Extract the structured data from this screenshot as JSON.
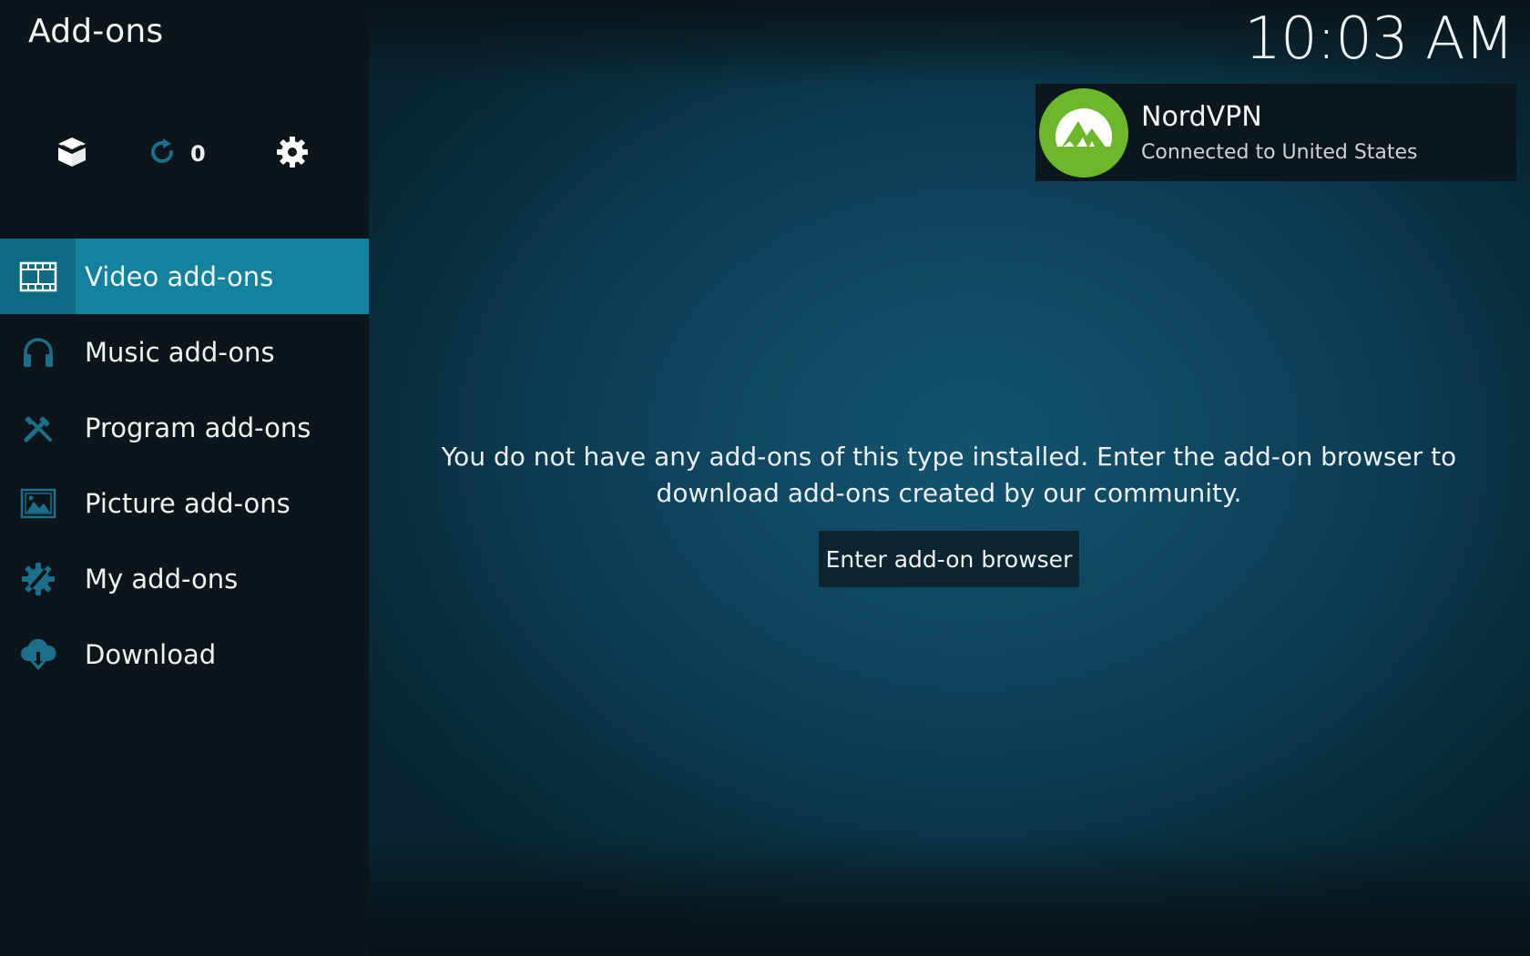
{
  "window": {
    "title": "Add-ons",
    "clock": "10:03 AM"
  },
  "toolbar": {
    "addon_browser_icon": "open-box-icon",
    "updates_icon": "refresh-icon",
    "updates_count": "0",
    "settings_icon": "gear-icon"
  },
  "sidebar": {
    "items": [
      {
        "label": "Video add-ons",
        "icon": "film-strip-icon",
        "active": true
      },
      {
        "label": "Music add-ons",
        "icon": "headphones-icon",
        "active": false
      },
      {
        "label": "Program add-ons",
        "icon": "tools-icon",
        "active": false
      },
      {
        "label": "Picture add-ons",
        "icon": "picture-icon",
        "active": false
      },
      {
        "label": "My add-ons",
        "icon": "gear-wrench-icon",
        "active": false
      },
      {
        "label": "Download",
        "icon": "cloud-download-icon",
        "active": false
      }
    ]
  },
  "notification": {
    "title": "NordVPN",
    "subtitle": "Connected to United States",
    "logo_color": "#6fb72a"
  },
  "main": {
    "empty_message": "You do not have any add-ons of this type installed. Enter the add-on browser to download add-ons created by our community.",
    "browser_button_label": "Enter add-on browser"
  },
  "colors": {
    "accent": "#12829f",
    "accent_dark": "#0f6a83",
    "sidebar_bg": "#0c1519",
    "icon_muted": "#1c6f8a"
  }
}
